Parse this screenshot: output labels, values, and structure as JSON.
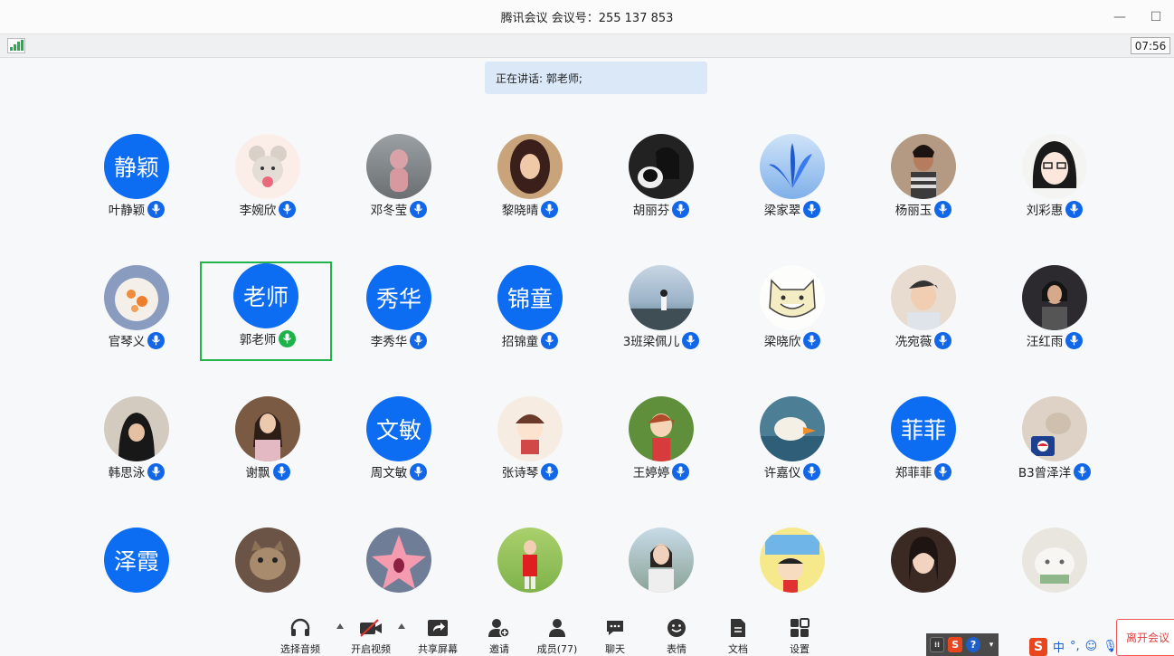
{
  "window": {
    "title": "腾讯会议 会议号：255 137 853"
  },
  "status": {
    "time": "07:56"
  },
  "speaking": {
    "text": "正在讲话: 郭老师;"
  },
  "participants": [
    {
      "name": "叶静颖",
      "avatar_text": "静颖",
      "avatar_color": "#0c6cf2"
    },
    {
      "name": "李婉欣",
      "avatar_photo": "cartoon-mouse"
    },
    {
      "name": "邓冬莹",
      "avatar_photo": "pink-costume-child"
    },
    {
      "name": "黎晓晴",
      "avatar_photo": "drawn-woman"
    },
    {
      "name": "胡丽芬",
      "avatar_photo": "girl-with-dog"
    },
    {
      "name": "梁家翠",
      "avatar_photo": "blue-flower"
    },
    {
      "name": "杨丽玉",
      "avatar_photo": "girl-portrait"
    },
    {
      "name": "刘彩惠",
      "avatar_photo": "cartoon-girl"
    },
    {
      "name": "官琴义",
      "avatar_photo": "orange-pomelo"
    },
    {
      "name": "郭老师",
      "avatar_text": "老师",
      "avatar_color": "#0c6cf2",
      "active": true
    },
    {
      "name": "李秀华",
      "avatar_text": "秀华",
      "avatar_color": "#0c6cf2"
    },
    {
      "name": "招锦童",
      "avatar_text": "锦童",
      "avatar_color": "#0c6cf2"
    },
    {
      "name": "3班梁佩儿",
      "avatar_photo": "sea-view"
    },
    {
      "name": "梁晓欣",
      "avatar_photo": "cartoon-cat"
    },
    {
      "name": "冼宛薇",
      "avatar_photo": "boy-smiling"
    },
    {
      "name": "汪红雨",
      "avatar_photo": "child-dark"
    },
    {
      "name": "韩思泳",
      "avatar_photo": "child-hood"
    },
    {
      "name": "谢飘",
      "avatar_photo": "girl-room"
    },
    {
      "name": "周文敏",
      "avatar_text": "文敏",
      "avatar_color": "#0c6cf2"
    },
    {
      "name": "张诗琴",
      "avatar_photo": "anime-girl"
    },
    {
      "name": "王婷婷",
      "avatar_photo": "anime-forest"
    },
    {
      "name": "许嘉仪",
      "avatar_photo": "duck"
    },
    {
      "name": "郑菲菲",
      "avatar_text": "菲菲",
      "avatar_color": "#0c6cf2"
    },
    {
      "name": "B3曾泽洋",
      "avatar_photo": "cat-can"
    },
    {
      "name": "",
      "avatar_text": "泽霞",
      "avatar_color": "#0c6cf2"
    },
    {
      "name": "",
      "avatar_photo": "cat-face"
    },
    {
      "name": "",
      "avatar_photo": "patrick-star"
    },
    {
      "name": "",
      "avatar_photo": "girl-red"
    },
    {
      "name": "",
      "avatar_photo": "girl-outdoor"
    },
    {
      "name": "",
      "avatar_photo": "crayon-shin"
    },
    {
      "name": "",
      "avatar_photo": "girl-face"
    },
    {
      "name": "",
      "avatar_photo": "white-cat"
    }
  ],
  "toolbar": {
    "audio": "选择音频",
    "video": "开启视频",
    "share": "共享屏幕",
    "invite": "邀请",
    "members": "成员(77)",
    "chat": "聊天",
    "emoji": "表情",
    "docs": "文档",
    "settings": "设置",
    "leave": "离开会议"
  },
  "ime": {
    "lang": "中"
  }
}
